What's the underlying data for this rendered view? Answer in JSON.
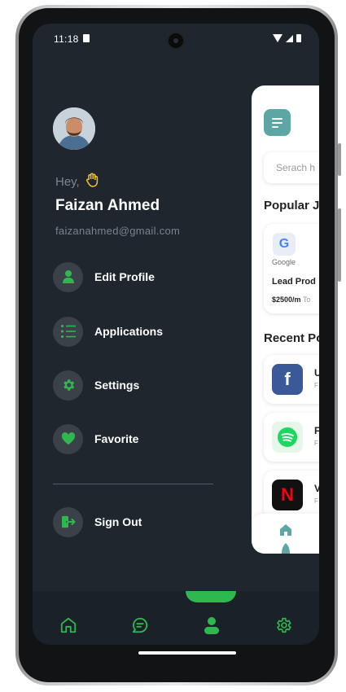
{
  "status_bar": {
    "time": "11:18"
  },
  "drawer": {
    "greeting": "Hey,",
    "name": "Faizan Ahmed",
    "email": "faizanahmed@gmail.com",
    "menu": [
      {
        "label": "Edit Profile",
        "icon": "user-icon"
      },
      {
        "label": "Applications",
        "icon": "list-icon"
      },
      {
        "label": "Settings",
        "icon": "gear-icon"
      },
      {
        "label": "Favorite",
        "icon": "heart-icon"
      }
    ],
    "sign_out": {
      "label": "Sign Out",
      "icon": "sign-out-icon"
    }
  },
  "preview": {
    "search_placeholder": "Serach h",
    "popular_heading": "Popular J",
    "job": {
      "company": "Google",
      "role": "Lead Prod",
      "salary": "$2500/m",
      "salary_suffix": "To"
    },
    "recent_heading": "Recent Po",
    "recent": [
      {
        "initial": "U",
        "sub": "F",
        "logo": "facebook-icon"
      },
      {
        "initial": "F",
        "sub": "F",
        "logo": "spotify-icon"
      },
      {
        "initial": "V",
        "sub": "F",
        "logo": "netflix-icon"
      }
    ]
  },
  "bottom_nav": {
    "items": [
      "home-icon",
      "chat-icon",
      "profile-icon",
      "gear-icon"
    ],
    "active": "profile-icon"
  },
  "colors": {
    "accent": "#2fb84f",
    "background": "#1f262e",
    "icon_bg": "#3a4149",
    "preview_accent": "#5ea6a3"
  }
}
